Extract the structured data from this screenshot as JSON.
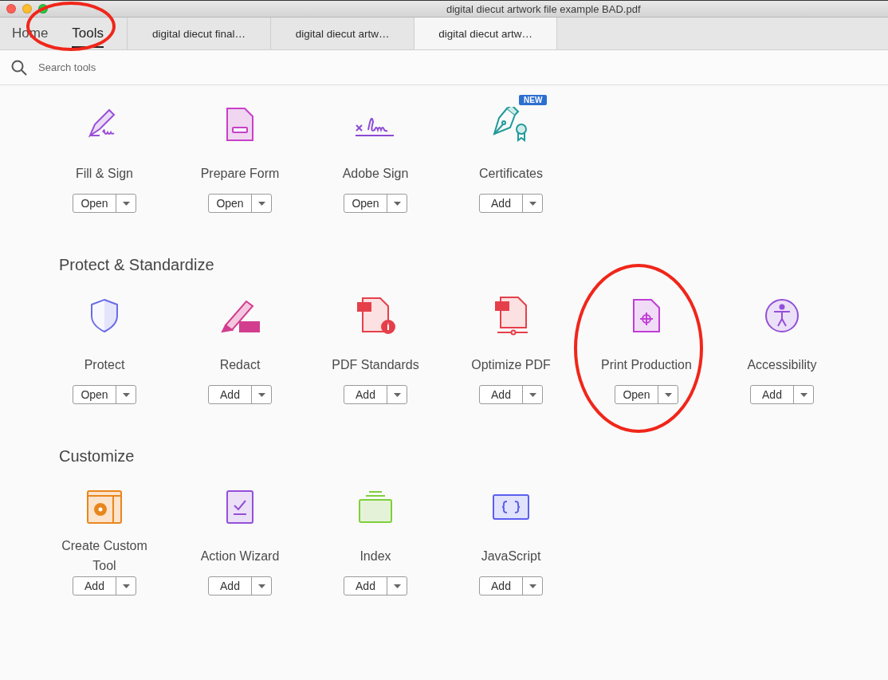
{
  "window": {
    "title": "digital diecut artwork file example BAD.pdf"
  },
  "tabs": [
    {
      "label": "Home",
      "selected": false,
      "kind": "nav"
    },
    {
      "label": "Tools",
      "selected": true,
      "circled": true,
      "kind": "nav"
    },
    {
      "label": "digital diecut final…",
      "selected": false,
      "kind": "doc"
    },
    {
      "label": "digital diecut artw…",
      "selected": false,
      "kind": "doc"
    },
    {
      "label": "digital diecut artw…",
      "selected": true,
      "kind": "doc"
    }
  ],
  "search": {
    "placeholder": "Search tools"
  },
  "sections": [
    {
      "tools": [
        {
          "kind": "fill-sign",
          "label": "Fill & Sign",
          "action": "Open"
        },
        {
          "kind": "prepare-form",
          "label": "Prepare Form",
          "action": "Open"
        },
        {
          "kind": "adobe-sign",
          "label": "Adobe Sign",
          "action": "Open"
        },
        {
          "kind": "certificates",
          "label": "Certificates",
          "action": "Add",
          "badge": "NEW"
        }
      ]
    },
    {
      "title": "Protect & Standardize",
      "tools": [
        {
          "kind": "protect",
          "label": "Protect",
          "action": "Open"
        },
        {
          "kind": "redact",
          "label": "Redact",
          "action": "Add"
        },
        {
          "kind": "pdf-standards",
          "label": "PDF Standards",
          "action": "Add"
        },
        {
          "kind": "optimize",
          "label": "Optimize PDF",
          "action": "Add"
        },
        {
          "kind": "print",
          "label": "Print Production",
          "action": "Open",
          "circled": true
        },
        {
          "kind": "accessibility",
          "label": "Accessibility",
          "action": "Add"
        }
      ]
    },
    {
      "title": "Customize",
      "tools": [
        {
          "kind": "custom-tool",
          "label": "Create Custom Tool",
          "action": "Add"
        },
        {
          "kind": "action-wizard",
          "label": "Action Wizard",
          "action": "Add"
        },
        {
          "kind": "index",
          "label": "Index",
          "action": "Add"
        },
        {
          "kind": "javascript",
          "label": "JavaScript",
          "action": "Add"
        }
      ]
    }
  ]
}
